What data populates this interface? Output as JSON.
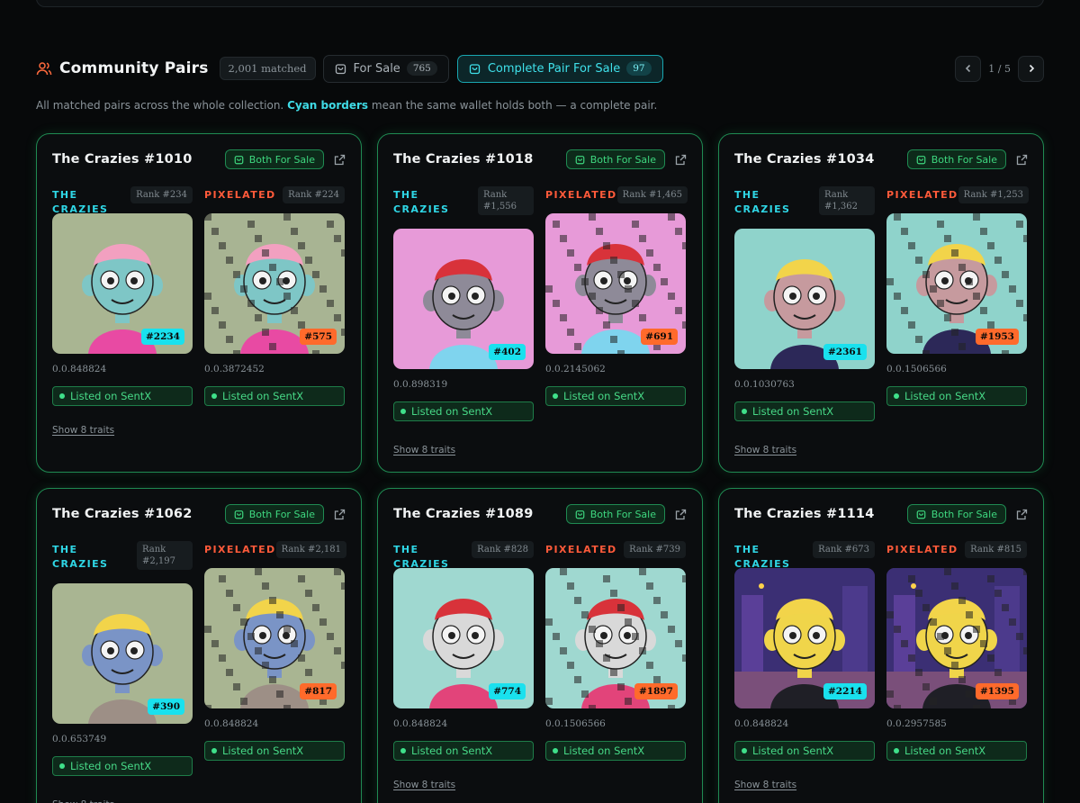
{
  "section": {
    "title": "Community Pairs",
    "matched": "2,001 matched",
    "filters": [
      {
        "label": "For Sale",
        "count": "765"
      },
      {
        "label": "Complete Pair For Sale",
        "count": "97"
      }
    ],
    "pager": "1 / 5",
    "subtitle_pre": "All matched pairs across the whole collection.",
    "subtitle_hl": "Cyan borders",
    "subtitle_post": "mean the same wallet holds both — a complete pair."
  },
  "labels": {
    "both_for_sale": "Both For Sale",
    "listed": "Listed on SentX",
    "show_traits": "Show 8 traits",
    "crazies": "THE CRAZIES",
    "pixelated": "PIXELATED"
  },
  "colors": {
    "accent_cyan": "#2fd7e6",
    "accent_green": "#3ed77f",
    "accent_orange": "#ff5a3a",
    "background": "#07090a"
  },
  "cards": [
    {
      "title": "The Crazies #1010",
      "crazies": {
        "rank": "Rank #234",
        "token": "#2234",
        "price": "0.0.848824"
      },
      "pixel": {
        "rank": "Rank #224",
        "token": "#575",
        "price": "0.0.3872452"
      }
    },
    {
      "title": "The Crazies #1018",
      "crazies": {
        "rank": "Rank #1,556",
        "token": "#402",
        "price": "0.0.898319"
      },
      "pixel": {
        "rank": "Rank #1,465",
        "token": "#691",
        "price": "0.0.2145062"
      }
    },
    {
      "title": "The Crazies #1034",
      "crazies": {
        "rank": "Rank #1,362",
        "token": "#2361",
        "price": "0.0.1030763"
      },
      "pixel": {
        "rank": "Rank #1,253",
        "token": "#1953",
        "price": "0.0.1506566"
      }
    },
    {
      "title": "The Crazies #1062",
      "crazies": {
        "rank": "Rank #2,197",
        "token": "#390",
        "price": "0.0.653749"
      },
      "pixel": {
        "rank": "Rank #2,181",
        "token": "#817",
        "price": "0.0.848824"
      }
    },
    {
      "title": "The Crazies #1089",
      "crazies": {
        "rank": "Rank #828",
        "token": "#774",
        "price": "0.0.848824"
      },
      "pixel": {
        "rank": "Rank #739",
        "token": "#1897",
        "price": "0.0.1506566"
      }
    },
    {
      "title": "The Crazies #1114",
      "crazies": {
        "rank": "Rank #673",
        "token": "#2214",
        "price": "0.0.848824"
      },
      "pixel": {
        "rank": "Rank #815",
        "token": "#1395",
        "price": "0.0.2957585"
      }
    }
  ]
}
